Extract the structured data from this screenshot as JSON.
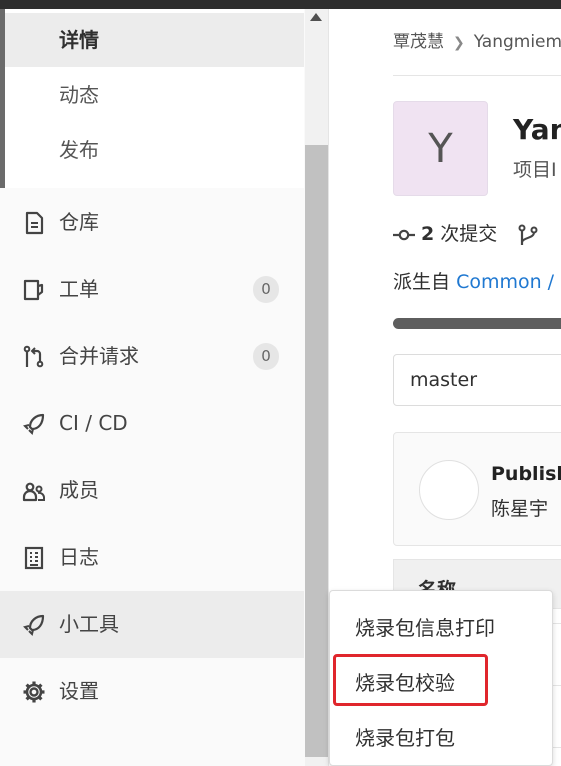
{
  "colors": {
    "accent_link": "#1f78d1",
    "highlight_box": "#e0262c",
    "avatar_bg": "#f0e3f2"
  },
  "sidebar": {
    "sub_items": [
      {
        "label": "详情",
        "active": true
      },
      {
        "label": "动态",
        "active": false
      },
      {
        "label": "发布",
        "active": false
      }
    ],
    "items": [
      {
        "label": "仓库",
        "icon": "document-icon"
      },
      {
        "label": "工单",
        "icon": "issues-icon",
        "badge": "0"
      },
      {
        "label": "合并请求",
        "icon": "merge-request-icon",
        "badge": "0"
      },
      {
        "label": "CI / CD",
        "icon": "rocket-icon"
      },
      {
        "label": "成员",
        "icon": "users-icon"
      },
      {
        "label": "日志",
        "icon": "log-icon"
      },
      {
        "label": "小工具",
        "icon": "rocket-icon",
        "active": true
      },
      {
        "label": "设置",
        "icon": "gear-icon"
      }
    ]
  },
  "main": {
    "breadcrumb": [
      "覃茂慧",
      "Yangmiem"
    ],
    "project": {
      "avatar_letter": "Y",
      "title": "Yan",
      "id_label": "项目I"
    },
    "stats": {
      "commits_count": "2",
      "commits_label": "次提交"
    },
    "forked": {
      "prefix": "派生自",
      "link": "Common /"
    },
    "branch": "master",
    "commit": {
      "title": "Publish",
      "author": "陈星宇"
    },
    "table_header": "名称"
  },
  "dropdown": {
    "items": [
      "烧录包信息打印",
      "烧录包校验",
      "烧录包打包"
    ],
    "highlighted_index": 1
  }
}
